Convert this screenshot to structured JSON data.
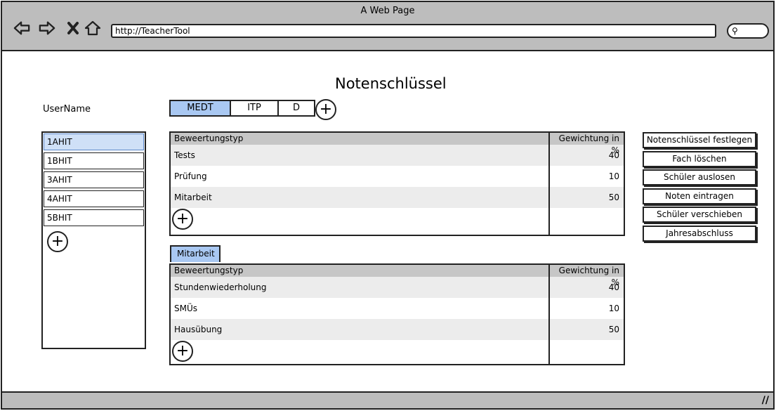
{
  "window": {
    "title": "A Web Page"
  },
  "browser": {
    "url": "http://TeacherTool",
    "nav_icons": [
      "back-arrow-icon",
      "forward-arrow-icon",
      "close-x-icon",
      "home-icon"
    ],
    "search_icon": "search-icon"
  },
  "page": {
    "title": "Notenschlüssel",
    "username": "UserName"
  },
  "subject_tabs": [
    {
      "label": "MEDT",
      "active": true
    },
    {
      "label": "ITP",
      "active": false
    },
    {
      "label": "D",
      "active": false
    }
  ],
  "classes": [
    {
      "label": "1AHIT",
      "selected": true
    },
    {
      "label": "1BHIT",
      "selected": false
    },
    {
      "label": "3AHIT",
      "selected": false
    },
    {
      "label": "4AHIT",
      "selected": false
    },
    {
      "label": "5BHIT",
      "selected": false
    }
  ],
  "grading_table": {
    "headers": [
      "Beweertungstyp",
      "Gewichtung in %"
    ],
    "rows": [
      {
        "type": "Tests",
        "weight": "40"
      },
      {
        "type": "Prüfung",
        "weight": "10"
      },
      {
        "type": "Mitarbeit",
        "weight": "50"
      }
    ]
  },
  "sub_tab": {
    "label": "Mitarbeit"
  },
  "mitarbeit_table": {
    "headers": [
      "Beweertungstyp",
      "Gewichtung in %"
    ],
    "rows": [
      {
        "type": "Stundenwiederholung",
        "weight": "40"
      },
      {
        "type": "SMÜs",
        "weight": "10"
      },
      {
        "type": "Hausübung",
        "weight": "50"
      }
    ]
  },
  "actions": [
    "Notenschlüssel festlegen",
    "Fach löschen",
    "Schüler auslosen",
    "Noten eintragen",
    "Schüler verschieben",
    "Jahresabschluss"
  ],
  "colors": {
    "chrome": "#bdbdbd",
    "selected_tab": "#a9c8f2",
    "selected_item": "#cfe0f7"
  }
}
